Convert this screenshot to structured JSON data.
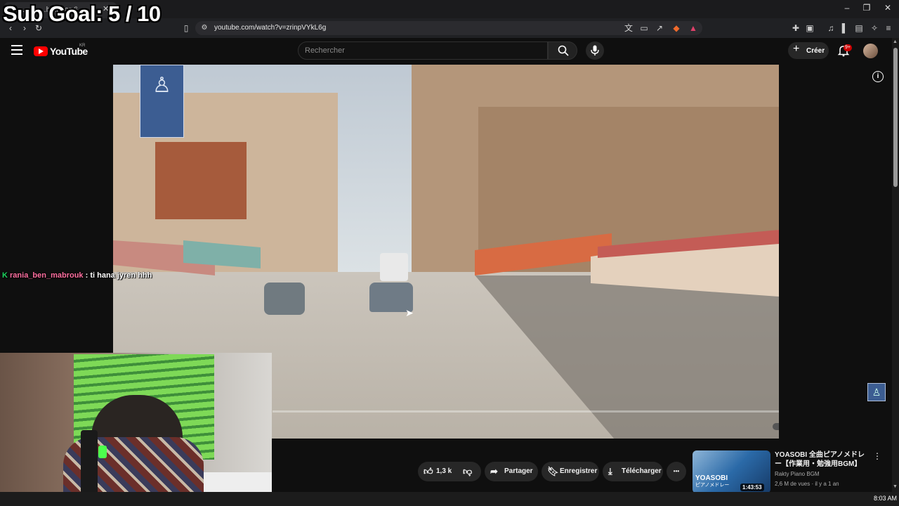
{
  "overlay": {
    "sub_goal": "Sub Goal: 5 / 10"
  },
  "browser": {
    "tab_title": "... ... ...hall dar 6...",
    "url": "youtube.com/watch?v=zrinpVYkL6g"
  },
  "header": {
    "brand": "YouTube",
    "region": "KR",
    "search_placeholder": "Rechercher",
    "create_label": "Créer",
    "notifications": "9+"
  },
  "chat": {
    "badge": "K",
    "user": "rania_ben_mabrouk",
    "message": " : ti hana jyren hhh"
  },
  "actions": {
    "likes": "1,3 k",
    "share": "Partager",
    "save": "Enregistrer",
    "download": "Télécharger",
    "more": "•••"
  },
  "recommended": {
    "title": "YOASOBI 全曲ピアノメドレー【作業用・勉強用BGM】",
    "channel": "Rakty Piano BGM",
    "meta": "2,6 M de vues · il y a 1 an",
    "duration": "1:43:53",
    "thumb_brand": "YOASOBI",
    "thumb_caption": "ピアノメドレー"
  },
  "taskbar": {
    "clock": "8:03 AM"
  },
  "icons": {
    "menu": "menu-icon",
    "search": "search-icon",
    "mic": "mic-icon",
    "bell": "bell-icon",
    "settings": "gear-icon",
    "info": "info-icon"
  },
  "colors": {
    "brand_red": "#ff0000",
    "background": "#0f0f0f",
    "chat_user": "#ff6fa0",
    "chat_badge": "#1ed760"
  }
}
